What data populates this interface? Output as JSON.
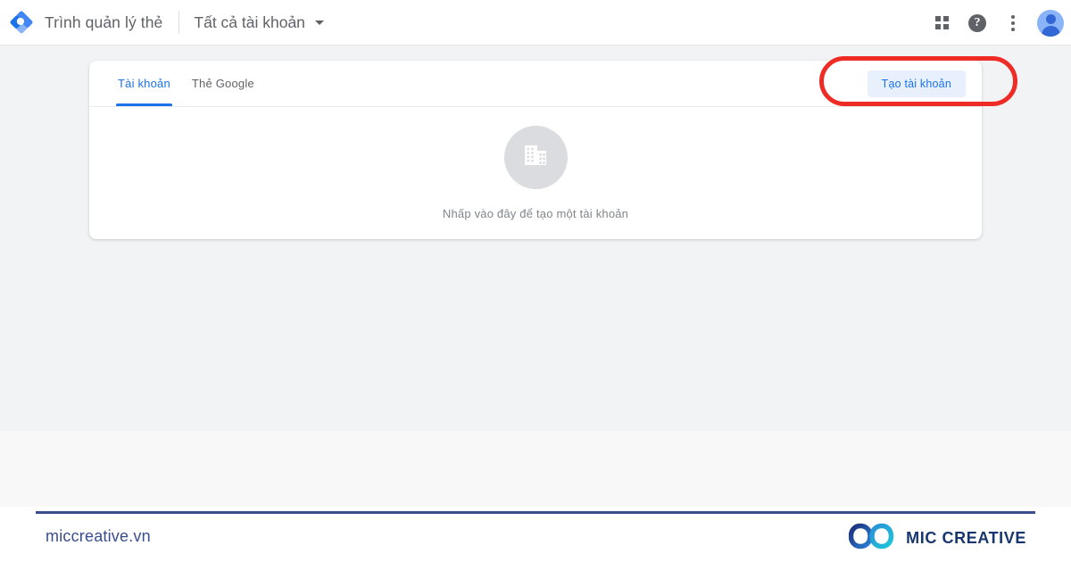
{
  "header": {
    "logo_icon": "gtm-diamond-icon",
    "product_title": "Trình quản lý thẻ",
    "account_selector_label": "Tất cả tài khoản",
    "caret_icon": "chevron-down-icon",
    "apps_icon": "apps-grid-icon",
    "help_icon": "help-question-icon",
    "help_glyph": "?",
    "more_icon": "kebab-menu-icon",
    "avatar_icon": "user-avatar-icon"
  },
  "card": {
    "tabs": [
      {
        "label": "Tài khoản",
        "active": true
      },
      {
        "label": "Thẻ Google",
        "active": false
      }
    ],
    "create_button_label": "Tạo tài khoản",
    "empty_state": {
      "icon": "office-building-icon",
      "text": "Nhấp vào đây để tạo một tài khoản"
    }
  },
  "annotation": {
    "shape": "red-oval-highlight",
    "color": "#ee2b24",
    "targets": "create-account-button"
  },
  "footer": {
    "url": "miccreative.vn",
    "brand": "MIC CREATIVE",
    "brand_icon": "mic-creative-infinity-logo"
  },
  "colors": {
    "accent_blue": "#1a73e8",
    "button_bg": "#e8f0fe",
    "page_bg": "#f1f3f4",
    "lower_band": "#f8f8f9",
    "footer_navy": "#3a4d8f",
    "annotation_red": "#ee2b24",
    "text_gray": "#5f6368"
  }
}
